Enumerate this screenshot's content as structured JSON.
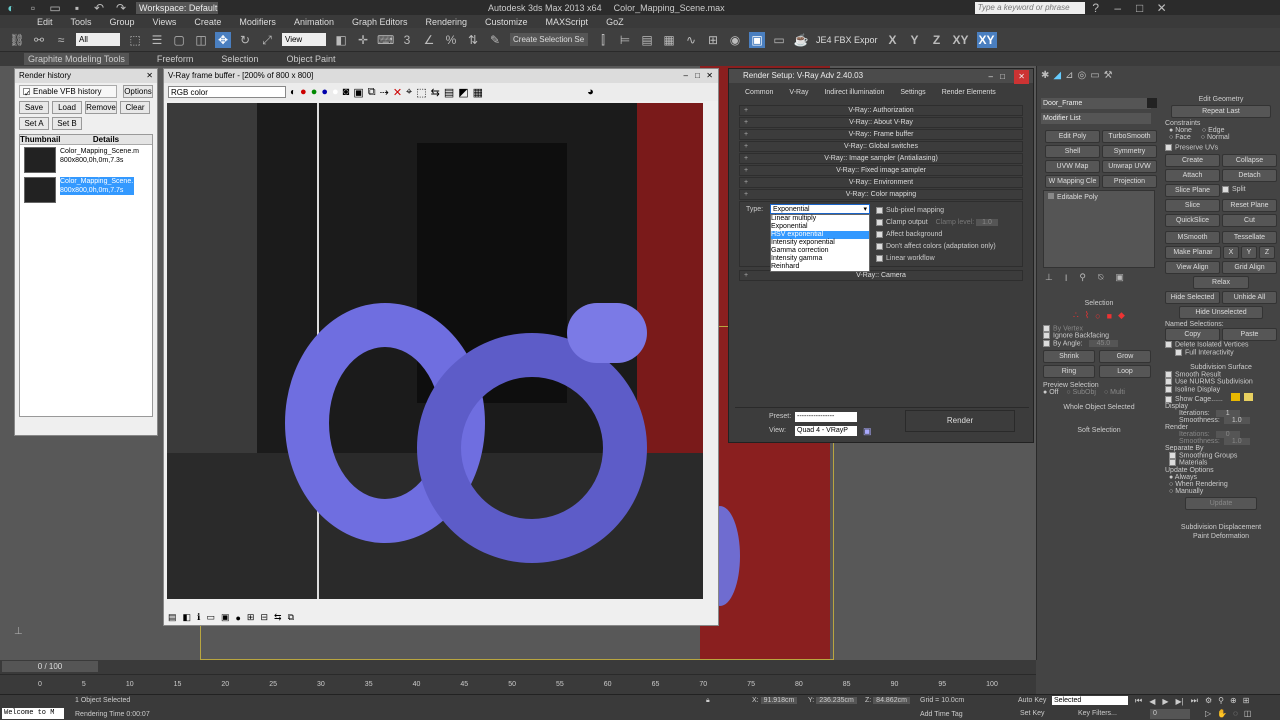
{
  "titlebar": {
    "workspace": "Workspace: Default",
    "app_title": "Autodesk 3ds Max  2013 x64",
    "file": "Color_Mapping_Scene.max",
    "search_placeholder": "Type a keyword or phrase"
  },
  "menu": [
    "Edit",
    "Tools",
    "Group",
    "Views",
    "Create",
    "Modifiers",
    "Animation",
    "Graph Editors",
    "Rendering",
    "Customize",
    "MAXScript",
    "GoZ"
  ],
  "toolbar": {
    "filter": "All",
    "view": "View",
    "selection_set": "Create Selection Se",
    "fbx": "JE4 FBX Expor",
    "axes": [
      "X",
      "Y",
      "Z",
      "XY",
      "XY"
    ]
  },
  "ribbon": {
    "tabs": [
      "Graphite Modeling Tools",
      "Freeform",
      "Selection",
      "Object Paint"
    ]
  },
  "render_history": {
    "title": "Render history",
    "enable": "Enable VFB history",
    "options": "Options",
    "buttons": [
      "Save",
      "Load",
      "Remove",
      "Clear"
    ],
    "set_a": "Set A",
    "set_b": "Set B",
    "col_thumb": "Thumbnail",
    "col_details": "Details",
    "items": [
      {
        "name": "Color_Mapping_Scene.m",
        "info": "800x800,0h,0m,7.3s"
      },
      {
        "name": "Color_Mapping_Scene.",
        "info": "800x800,0h,0m,7.7s"
      }
    ]
  },
  "vfb": {
    "title": "V-Ray frame buffer - [200% of 800 x 800]",
    "channel": "RGB color"
  },
  "render_setup": {
    "title": "Render Setup: V-Ray Adv 2.40.03",
    "tabs": [
      "Common",
      "V-Ray",
      "Indirect illumination",
      "Settings",
      "Render Elements"
    ],
    "rollouts": [
      "V-Ray:: Authorization",
      "V-Ray:: About V-Ray",
      "V-Ray:: Frame buffer",
      "V-Ray:: Global switches",
      "V-Ray:: Image sampler (Antialiasing)",
      "V-Ray:: Fixed image sampler",
      "V-Ray:: Environment"
    ],
    "color_mapping": "V-Ray:: Color mapping",
    "type_label": "Type:",
    "type_value": "Exponential",
    "dropdown": [
      "Linear multiply",
      "Exponential",
      "HSV exponential",
      "Intensity exponential",
      "Gamma correction",
      "Intensity gamma",
      "Reinhard"
    ],
    "options": [
      "Sub-pixel mapping",
      "Clamp output",
      "Affect background",
      "Don't affect colors (adaptation only)",
      "Linear workflow"
    ],
    "clamp_level_label": "Clamp level:",
    "clamp_level": "1.0",
    "camera": "V-Ray:: Camera",
    "preset_label": "Preset:",
    "preset": "----------------",
    "view_label": "View:",
    "view": "Quad 4 - VRayP",
    "render": "Render"
  },
  "cmd_panel": {
    "object_name": "Door_Frame",
    "modifier_list": "Modifier List",
    "mod_buttons": [
      "Edit Poly",
      "TurboSmooth",
      "Shell",
      "Symmetry",
      "UVW Map",
      "Unwrap UVW",
      "W Mapping Cle",
      "Projection"
    ],
    "stack": [
      "Editable Poly"
    ],
    "selection": "Selection",
    "by_vertex": "By Vertex",
    "ignore_backfacing": "Ignore Backfacing",
    "by_angle": "By Angle:",
    "angle": "45.0",
    "shrink": "Shrink",
    "grow": "Grow",
    "ring": "Ring",
    "loop": "Loop",
    "preview": "Preview Selection",
    "off": "Off",
    "subobj": "SubObj",
    "multi": "Multi",
    "whole": "Whole Object Selected",
    "soft": "Soft Selection"
  },
  "edit_geometry": {
    "title": "Edit Geometry",
    "repeat": "Repeat Last",
    "constraints": "Constraints",
    "none": "None",
    "edge": "Edge",
    "face": "Face",
    "normal": "Normal",
    "preserve": "Preserve UVs",
    "create": "Create",
    "collapse": "Collapse",
    "attach": "Attach",
    "detach": "Detach",
    "slice_plane": "Slice Plane",
    "split": "Split",
    "slice": "Slice",
    "reset_plane": "Reset Plane",
    "quickslice": "QuickSlice",
    "cut": "Cut",
    "msmooth": "MSmooth",
    "tessellate": "Tessellate",
    "make_planar": "Make Planar",
    "x": "X",
    "y": "Y",
    "z": "Z",
    "view_align": "View Align",
    "grid_align": "Grid Align",
    "relax": "Relax",
    "hide_selected": "Hide Selected",
    "unhide_all": "Unhide All",
    "hide_unselected": "Hide Unselected",
    "named": "Named Selections:",
    "copy": "Copy",
    "paste": "Paste",
    "delete_isolated": "Delete Isolated Vertices",
    "full_inter": "Full Interactivity"
  },
  "subdiv": {
    "title": "Subdivision Surface",
    "smooth_result": "Smooth Result",
    "nurms": "Use NURMS Subdivision",
    "isoline": "Isoline Display",
    "show_cage": "Show Cage......",
    "display": "Display",
    "iterations_label": "Iterations:",
    "iterations": "1",
    "smoothness_label": "Smoothness:",
    "smoothness": "1.0",
    "render": "Render",
    "r_iterations": "0",
    "r_smoothness": "1.0",
    "separate": "Separate By",
    "smoothing_groups": "Smoothing Groups",
    "materials": "Materials",
    "update_options": "Update Options",
    "always": "Always",
    "when_rendering": "When Rendering",
    "manually": "Manually",
    "update": "Update",
    "disp": "Subdivision Displacement",
    "paint": "Paint Deformation"
  },
  "timeline": {
    "frame": "0 / 100",
    "ticks": [
      "0",
      "5",
      "10",
      "15",
      "20",
      "25",
      "30",
      "35",
      "40",
      "45",
      "50",
      "55",
      "60",
      "65",
      "70",
      "75",
      "80",
      "85",
      "90",
      "95",
      "100"
    ]
  },
  "status": {
    "welcome": "Welcome to M",
    "selected": "1 Object Selected",
    "rendering_time": "Rendering Time 0:00:07",
    "x": "91.918cm",
    "y": "236.235cm",
    "z": "84.862cm",
    "grid": "Grid = 10.0cm",
    "add_time_tag": "Add Time Tag",
    "auto_key": "Auto Key",
    "key_selected": "Selected",
    "set_key": "Set Key",
    "key_filters": "Key Filters...",
    "frame_num": "0"
  }
}
